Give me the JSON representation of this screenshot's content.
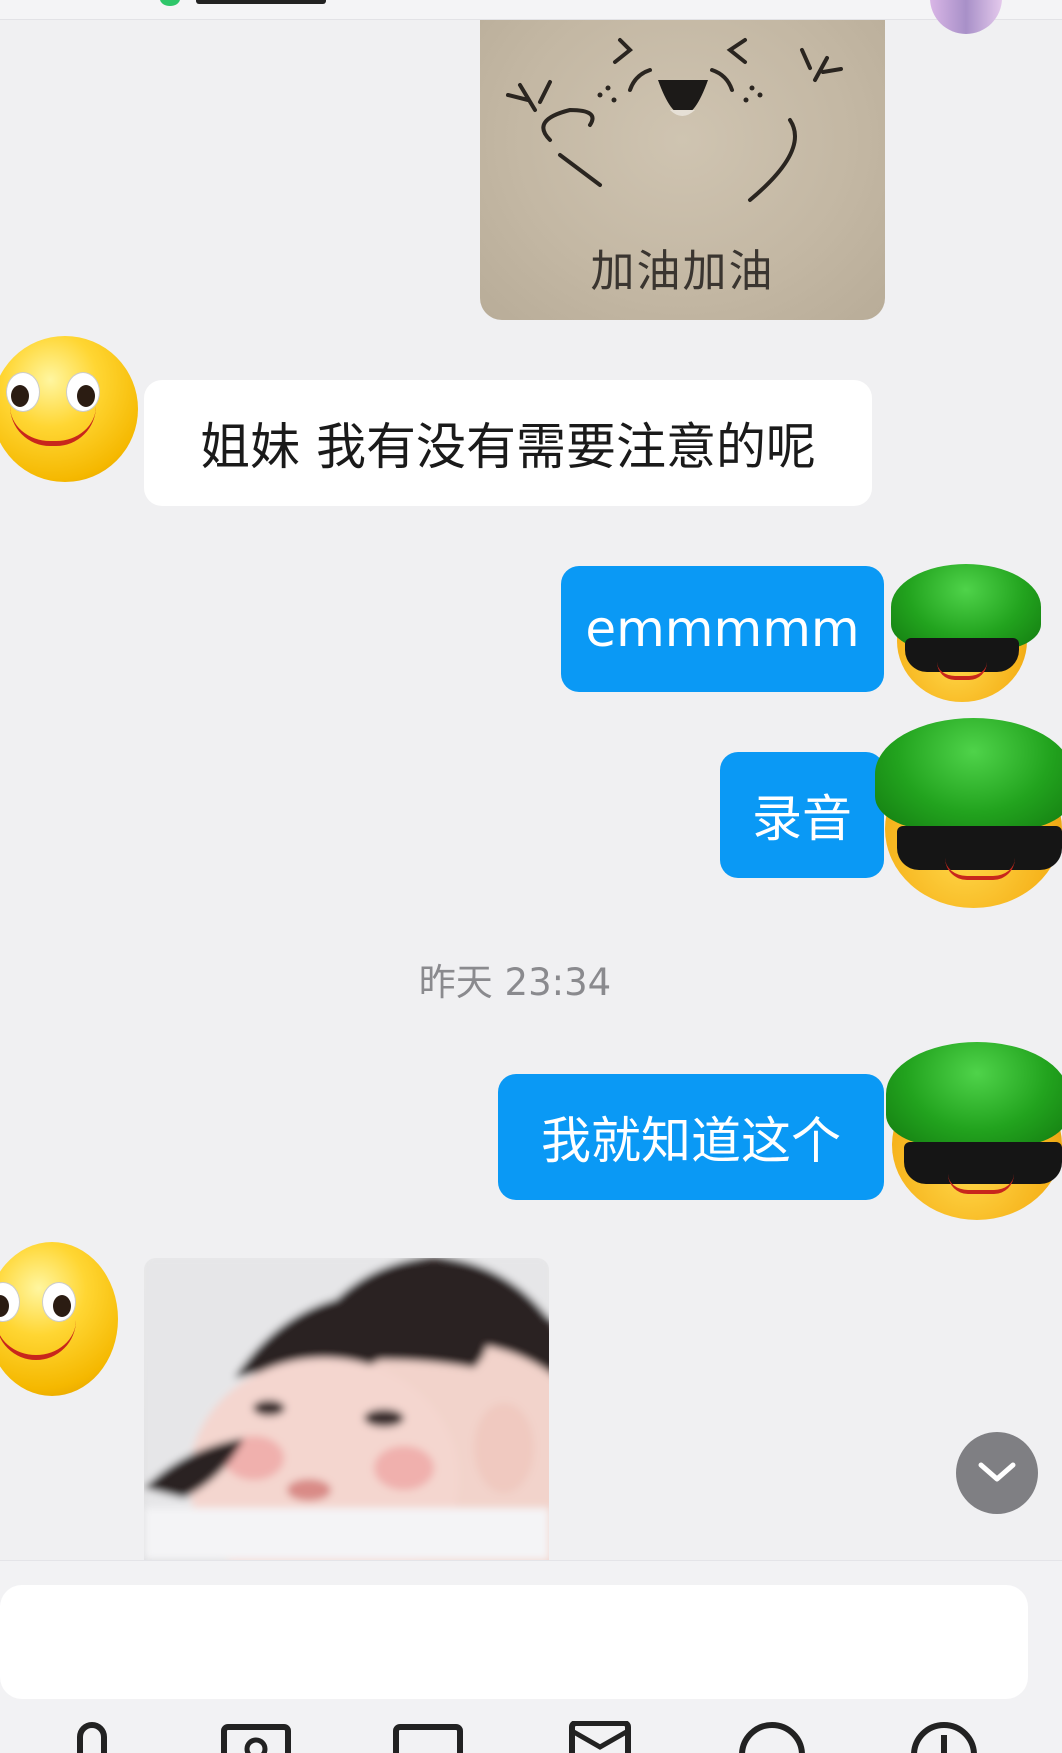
{
  "sticker": {
    "caption": "加油加油"
  },
  "messages": [
    {
      "side": "in",
      "text": "姐妹 我有没有需要注意的呢"
    },
    {
      "side": "out",
      "text": "emmmmm"
    },
    {
      "side": "out",
      "text": "录音"
    },
    {
      "side": "out",
      "text": "我就知道这个"
    }
  ],
  "timestamp": "昨天 23:34",
  "colors": {
    "outgoing_bubble": "#0a99f5",
    "incoming_bubble": "#ffffff",
    "background": "#f0f0f2"
  },
  "icons": [
    "smiley-avatar-icon",
    "turtle-avatar-icon",
    "chevron-down-icon",
    "mic-icon",
    "photo-icon",
    "image-icon",
    "red-packet-icon",
    "emoji-icon",
    "add-icon"
  ]
}
